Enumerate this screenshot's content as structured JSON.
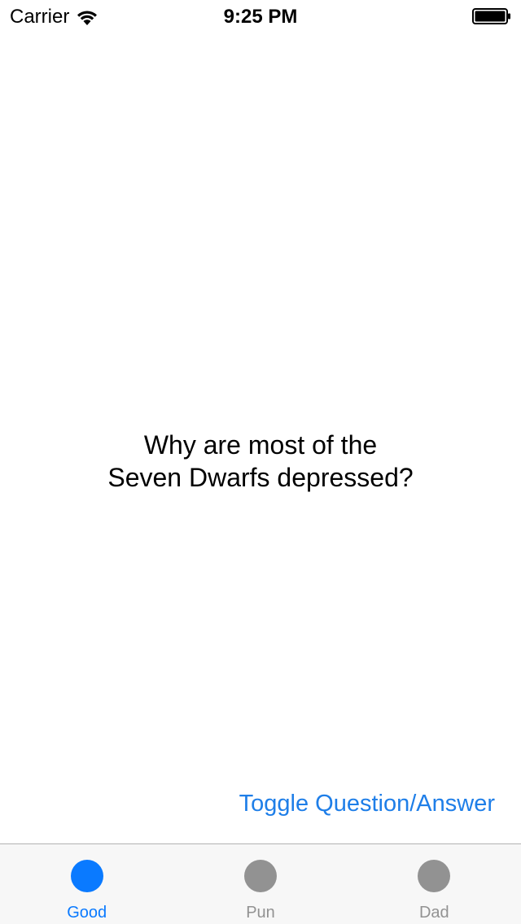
{
  "status_bar": {
    "carrier": "Carrier",
    "time": "9:25 PM",
    "wifi_icon": "wifi-icon",
    "battery_icon": "battery-icon"
  },
  "joke": {
    "line1": "Why are most of the",
    "line2": "Seven Dwarfs depressed?"
  },
  "toggle_button_label": "Toggle Question/Answer",
  "tab_bar": {
    "tabs": [
      {
        "label": "Good",
        "icon": "circle-icon",
        "active": true
      },
      {
        "label": "Pun",
        "icon": "circle-icon",
        "active": false
      },
      {
        "label": "Dad",
        "icon": "circle-icon",
        "active": false
      }
    ]
  },
  "colors": {
    "accent": "#0a7aff",
    "inactive": "#929292",
    "tab_bar_bg": "#f7f7f7"
  }
}
